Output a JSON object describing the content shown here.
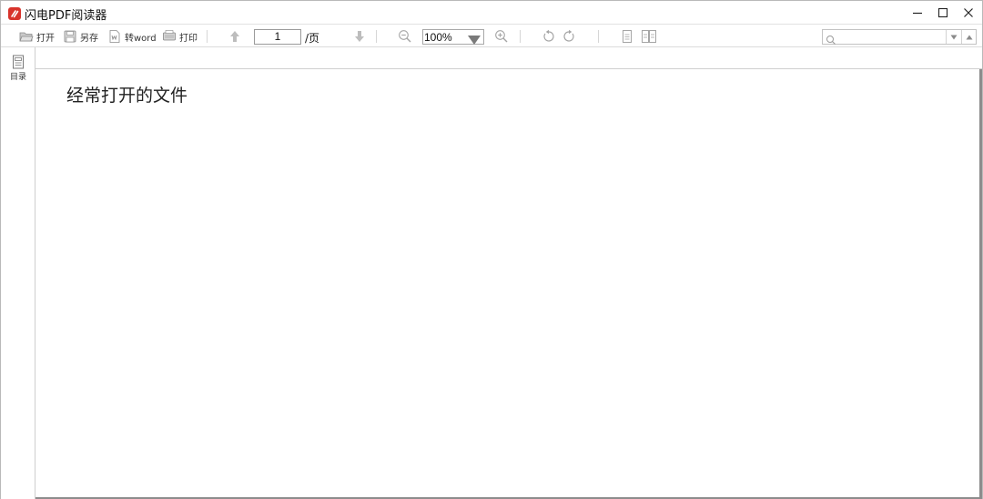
{
  "window": {
    "title": "闪电PDF阅读器",
    "accent_color": "#d8332b",
    "controls": [
      "minimize-icon",
      "maximize-icon",
      "close-icon"
    ]
  },
  "toolbar": {
    "open_label": "打开",
    "save_as_label": "另存",
    "to_word_label": "转word",
    "print_label": "打印",
    "page_current": "1",
    "page_suffix": "/页",
    "zoom_value": "100%",
    "search_placeholder": ""
  },
  "sidebar": {
    "toc_label": "目录"
  },
  "document": {
    "heading": "经常打开的文件"
  }
}
